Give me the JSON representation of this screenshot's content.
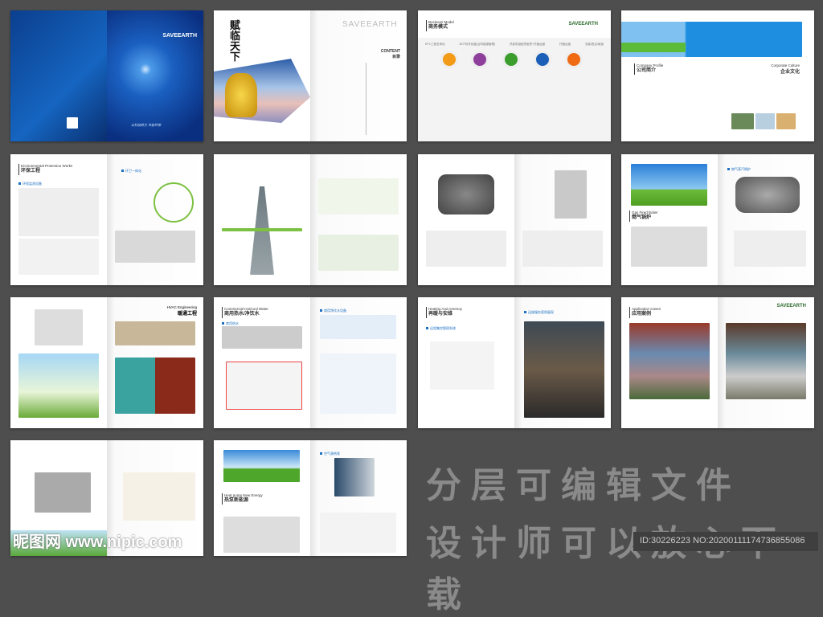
{
  "brand": "SAVEEARTH",
  "cover": {
    "slogan": "以科技助力 节能环保"
  },
  "contents": {
    "title": "CONTENT",
    "subtitle": "目录",
    "calligraphy": "赋临天下"
  },
  "business_model": {
    "title_en": "Business Model",
    "title_cn": "商务模式",
    "steps": [
      "EPC工程总承包",
      "BOT特许经营(合同能源管理)",
      "热泵机组租赁租赁+托管运营",
      "托管运营",
      "安装/售后/维保"
    ],
    "colors": [
      "#f39a16",
      "#8e3f9c",
      "#3a9d2c",
      "#1b5fb8",
      "#ef6a12"
    ]
  },
  "profile": {
    "title_en": "Company Profile",
    "title_cn": "公司简介",
    "culture_en": "Corporate Culture",
    "culture_cn": "企业文化"
  },
  "env": {
    "title_en": "Environmental Protection Works",
    "title_cn": "环保工程",
    "tag1": "环保监测设备",
    "tag2": "环卫一体化"
  },
  "boiler": {
    "title_en": "Gas Fired Boiler",
    "title_cn": "燃气锅炉",
    "tag": "燃气蒸汽锅炉"
  },
  "hvac": {
    "title_en": "HVAC Engineering",
    "title_cn": "暖通工程"
  },
  "water": {
    "title_en": "Commercial Hot/cool Water",
    "title_cn": "商用热水/净饮水",
    "tag1": "商用热水",
    "tag2": "商用净饮水设备"
  },
  "heating": {
    "title_en": "Heating And Amenoy",
    "title_cn": " 再暖与安维",
    "tag1": "远程集控管理系统",
    "tag2": "运维服务案例展现"
  },
  "cases": {
    "title_en": "Application Cases",
    "title_cn": "应用案例"
  },
  "heatpump": {
    "title_en": "Heat pump New Energy",
    "title_cn": "热泵新能源",
    "tag": "空气源热泵"
  },
  "promo": {
    "line1": "分层可编辑文件",
    "line2": "设计师可以放心下载",
    "id_text": "ID:30226223 NO:20200111174736855086"
  },
  "watermark": "昵图网 www.nipic.com"
}
